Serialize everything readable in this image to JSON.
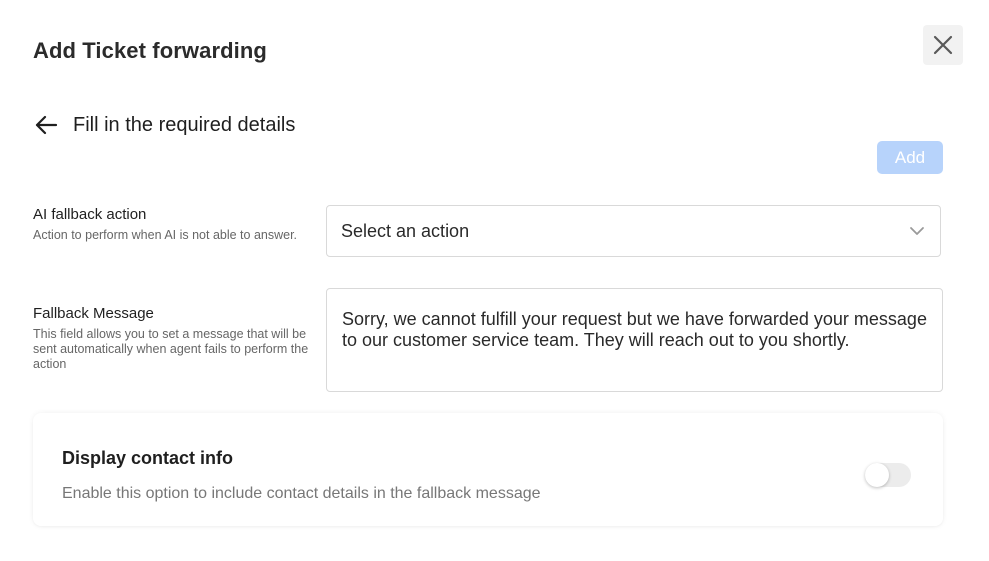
{
  "modal": {
    "title": "Add Ticket forwarding",
    "subtitle": "Fill in the required details",
    "add_label": "Add"
  },
  "fallback_action": {
    "label": "AI fallback action",
    "description": "Action to perform when AI is not able to answer.",
    "selected_value": "Select an action"
  },
  "fallback_message": {
    "label": "Fallback Message",
    "description": "This field allows you to set a message that will be sent automatically when agent fails to perform the action",
    "value": "Sorry, we cannot fulfill your request but we have forwarded your message to our customer service team. They will reach out to you shortly."
  },
  "contact_info": {
    "title": "Display contact info",
    "description": "Enable this option to include contact details in the fallback message",
    "enabled": false
  },
  "icons": {
    "close": "close-icon",
    "back": "arrow-left-icon",
    "dropdown": "chevron-down-icon"
  },
  "colors": {
    "add_button_disabled": "#b7d3fb",
    "toggle_off": "#ececec"
  }
}
